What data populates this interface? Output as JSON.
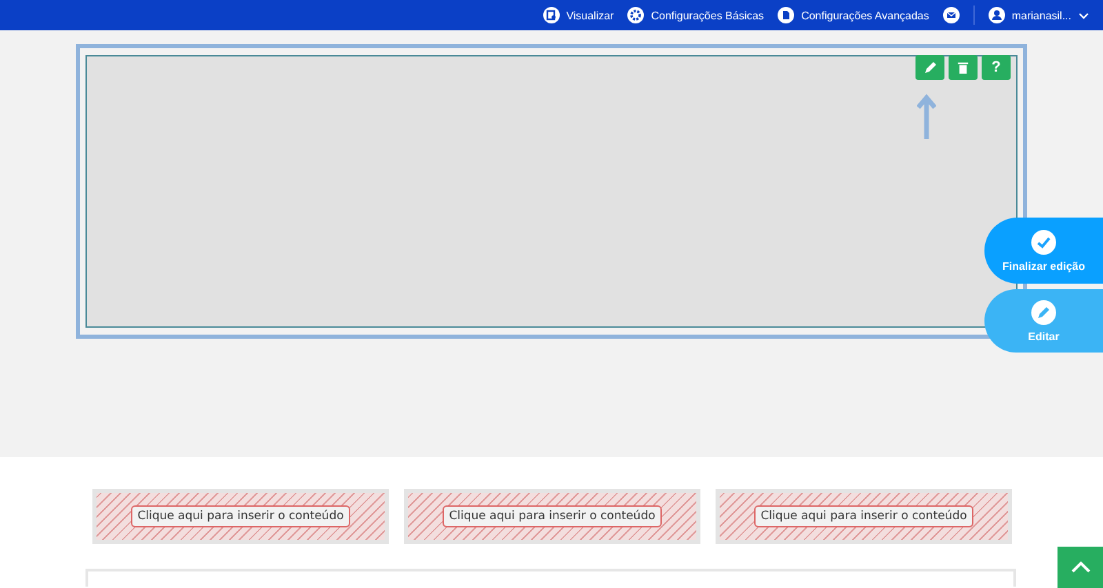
{
  "top_bar": {
    "items": [
      {
        "kind": "preview",
        "label": "Visualizar"
      },
      {
        "kind": "gear",
        "label": "Configurações Básicas"
      },
      {
        "kind": "page",
        "label": "Configurações Avançadas"
      }
    ],
    "user": {
      "name": "marianasil..."
    }
  },
  "editor_block": {
    "tools": [
      {
        "kind": "pencil"
      },
      {
        "kind": "trash"
      },
      {
        "kind": "help",
        "label": "?"
      }
    ]
  },
  "floating_buttons": [
    {
      "kind": "check",
      "label": "Finalizar edição"
    },
    {
      "kind": "pencil",
      "label": "Editar"
    }
  ],
  "content_slots": [
    {
      "label": "Clique aqui para inserir o conteúdo"
    },
    {
      "label": "Clique aqui para inserir o conteúdo"
    },
    {
      "label": "Clique aqui para inserir o conteúdo"
    }
  ]
}
